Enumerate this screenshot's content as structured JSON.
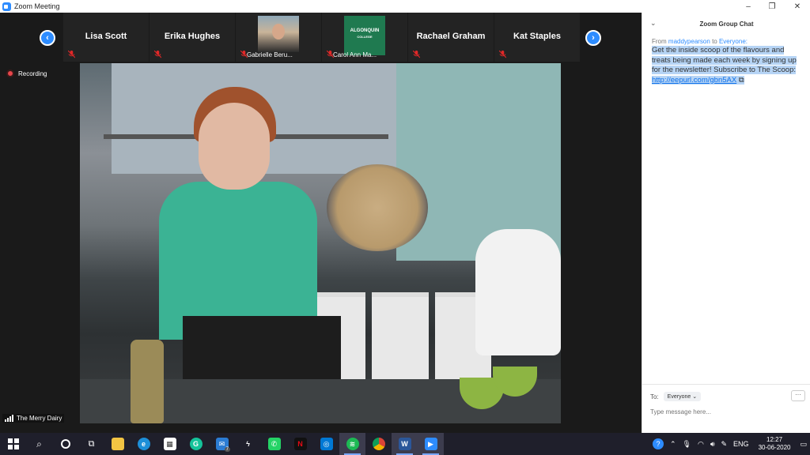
{
  "window": {
    "title": "Zoom Meeting",
    "minimize": "–",
    "maximize": "❐",
    "close": "✕"
  },
  "participants": [
    {
      "name": "Lisa Scott",
      "type": "name"
    },
    {
      "name": "Erika Hughes",
      "type": "name"
    },
    {
      "name": "Gabrielle Beru...",
      "type": "photo"
    },
    {
      "name": "Carol Ann Ma...",
      "type": "logo",
      "logo_text": "ALGONQUIN",
      "logo_sub": "COLLEGE"
    },
    {
      "name": "Rachael Graham",
      "type": "name"
    },
    {
      "name": "Kat Staples",
      "type": "name"
    }
  ],
  "recording_label": "Recording",
  "active_speaker": "The Merry Dairy",
  "chat": {
    "title": "Zoom Group Chat",
    "from_prefix": "From",
    "from_user": "maddypearson",
    "to_word": "to",
    "to_user": "Everyone:",
    "message_text": "Get the inside scoop of the flavours and treats being made each week by signing up for the newsletter! Subscribe to The Scoop: ",
    "message_link": "http://eepurl.com/gbn5AX",
    "to_label": "To:",
    "to_value": "Everyone",
    "more": "···",
    "input_placeholder": "Type message here..."
  },
  "taskbar": {
    "language": "ENG",
    "time": "12:27",
    "date": "30-06-2020",
    "mail_badge": "7"
  },
  "colors": {
    "zoom_blue": "#2d8cff",
    "recording_red": "#e8464b",
    "muted_red": "#e02828"
  }
}
